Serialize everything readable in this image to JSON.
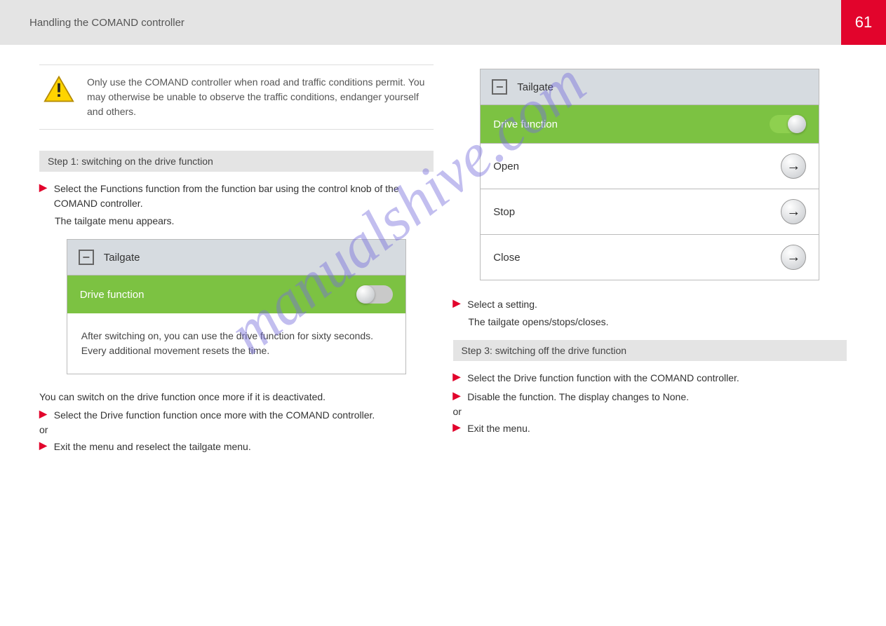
{
  "page_number": "61",
  "header_title": "Handling the COMAND controller",
  "watermark_text": "manualshive.com",
  "left": {
    "warning_text": "Only use the COMAND controller when road and traffic conditions permit. You may otherwise be unable to observe the traffic conditions, endanger yourself and others.",
    "step_1": {
      "label": "Step 1: switching on the drive function",
      "bullets": [
        "Select the Functions function from the function bar using the control knob of the COMAND controller.",
        "The tailgate menu appears."
      ]
    },
    "panelA": {
      "title": "Tailgate",
      "toggle_row": "Drive function",
      "desc": "After switching on, you can use the drive function for sixty seconds. Every additional movement resets the time."
    },
    "step_2": {
      "lead": "You can switch on the drive function once more if it is deactivated.",
      "bullets": [
        "Select the Drive function function once more with the COMAND controller.",
        "or",
        "Exit the menu and reselect the tailgate menu."
      ]
    }
  },
  "right": {
    "panelB": {
      "title": "Tailgate",
      "toggle_row": "Drive function",
      "rows": [
        "Open",
        "Stop",
        "Close"
      ]
    },
    "after_bullets": [
      "Select a setting.",
      "The tailgate opens/stops/closes."
    ],
    "step_3": {
      "label": "Step 3: switching off the drive function",
      "bullets": [
        "Select the Drive function function with the COMAND controller.",
        "Disable the function. The display changes to None.",
        "or",
        "Exit the menu."
      ]
    }
  }
}
